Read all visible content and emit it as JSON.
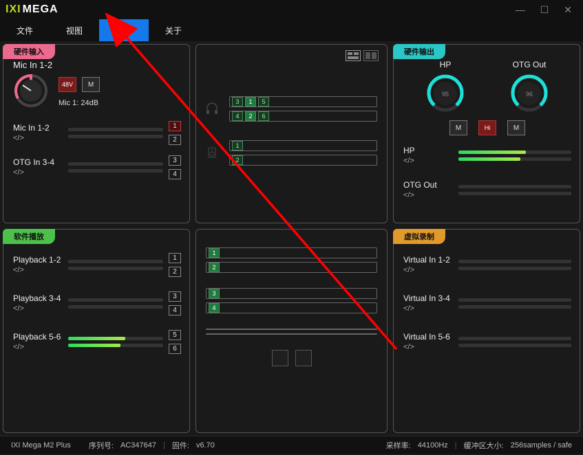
{
  "app": {
    "logo_part1": "IXI",
    "logo_part2": "MEGA"
  },
  "winctrls": {
    "min": "—",
    "max": "☐",
    "close": "✕"
  },
  "menu": {
    "items": [
      "文件",
      "视图",
      "设置",
      "关于"
    ],
    "active_index": 2
  },
  "panels": {
    "hw_input": {
      "title": "硬件输入",
      "mic_label": "Mic In 1-2",
      "btn_48v": "48V",
      "btn_m": "M",
      "mic_gain": "Mic 1: 24dB",
      "channels": [
        {
          "name": "Mic In 1-2",
          "sub": "</>",
          "nums": [
            "1",
            "2"
          ],
          "fills": [
            0,
            0
          ],
          "redbox": [
            true,
            false
          ]
        },
        {
          "name": "OTG In 3-4",
          "sub": "</>",
          "nums": [
            "3",
            "4"
          ],
          "fills": [
            0,
            0
          ],
          "redbox": [
            false,
            false
          ]
        }
      ]
    },
    "sw_play": {
      "title": "软件播放",
      "channels": [
        {
          "name": "Playback 1-2",
          "sub": "</>",
          "nums": [
            "1",
            "2"
          ],
          "fills": [
            0,
            0
          ]
        },
        {
          "name": "Playback 3-4",
          "sub": "</>",
          "nums": [
            "3",
            "4"
          ],
          "fills": [
            0,
            0
          ]
        },
        {
          "name": "Playback 5-6",
          "sub": "</>",
          "nums": [
            "5",
            "6"
          ],
          "fills": [
            60,
            55
          ]
        }
      ]
    },
    "hw_output": {
      "title": "硬件输出",
      "dials": [
        {
          "label": "HP",
          "value": "95"
        },
        {
          "label": "OTG Out",
          "value": "96"
        }
      ],
      "btns": {
        "m1": "M",
        "hi": "Hi",
        "m2": "M"
      },
      "channels": [
        {
          "name": "HP",
          "sub": "</>",
          "fills": [
            60,
            55
          ]
        },
        {
          "name": "OTG Out",
          "sub": "</>",
          "fills": [
            0,
            0
          ]
        }
      ]
    },
    "v_rec": {
      "title": "虚拟录制",
      "channels": [
        {
          "name": "Virtual In 1-2",
          "sub": "</>",
          "fills": [
            0,
            0
          ]
        },
        {
          "name": "Virtual In 3-4",
          "sub": "</>",
          "fills": [
            0,
            0
          ]
        },
        {
          "name": "Virtual In 5-6",
          "sub": "</>",
          "fills": [
            0,
            0
          ]
        }
      ]
    },
    "mid_top": {
      "rows": [
        {
          "icon": "headphones",
          "boxes": [
            [
              "3",
              "1",
              "5"
            ],
            [
              "4",
              "2",
              "6"
            ]
          ],
          "solid": [
            [
              false,
              true,
              false
            ],
            [
              false,
              true,
              false
            ]
          ]
        },
        {
          "icon": "speaker",
          "boxes": [
            [
              "1"
            ],
            [
              "2"
            ]
          ],
          "solid": [
            [
              false
            ],
            [
              false
            ]
          ]
        }
      ]
    },
    "mid_bot": {
      "rows": [
        {
          "boxes": [
            [
              "1"
            ],
            [
              "2"
            ]
          ],
          "solid": [
            [
              true
            ],
            [
              true
            ]
          ]
        },
        {
          "boxes": [
            [
              "3"
            ],
            [
              "4"
            ]
          ],
          "solid": [
            [
              true
            ],
            [
              true
            ]
          ]
        },
        {
          "boxes": [
            [],
            []
          ],
          "solid": [
            [],
            []
          ]
        }
      ]
    }
  },
  "status": {
    "device": "IXI Mega M2 Plus",
    "serial_label": "序列号:",
    "serial": "AC347647",
    "fw_label": "固件:",
    "fw": "v6.70",
    "sr_label": "采样率:",
    "sr": "44100Hz",
    "buf_label": "缓冲区大小:",
    "buf": "256samples / safe"
  }
}
